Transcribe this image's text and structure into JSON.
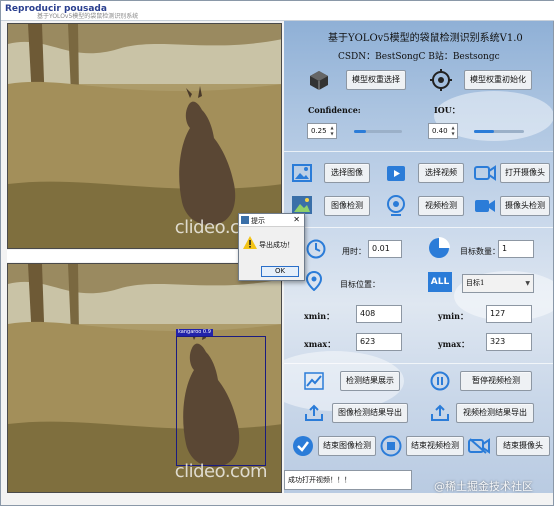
{
  "window": {
    "title": "Reproducir pousada",
    "subtitle": "基于YOLOv5模型的袋鼠检测识别系统"
  },
  "videos": {
    "watermark": "clideo.com",
    "detection_label": "kangaroo 0.9"
  },
  "panel": {
    "heading": "基于YOLOv5模型的袋鼠检测识别系统V1.0",
    "credits": "CSDN：BestSongC   B站：Bestsongc",
    "select_model_label": "模型权重选择",
    "init_model_label": "模型权重初始化",
    "confidence_label": "Confidence:",
    "confidence_value": "0.25",
    "confidence_level": 0.25,
    "iou_label": "IOU：",
    "iou_value": "0.40",
    "iou_level": 0.4,
    "select_image_label": "选择图像",
    "select_video_label": "选择视频",
    "open_camera_label": "打开摄像头",
    "image_detect_label": "图像检测",
    "video_detect_label": "视频检测",
    "camera_detect_label": "摄像头检测",
    "time_label": "用时：",
    "time_value": "0.01",
    "target_count_label": "目标数量：",
    "target_count_value": "1",
    "target_position_label": "目标位置：",
    "target_select_value": "目标1",
    "xmin_label": "xmin：",
    "xmin_value": "408",
    "ymin_label": "ymin：",
    "ymin_value": "127",
    "xmax_label": "xmax：",
    "xmax_value": "623",
    "ymax_label": "ymax：",
    "ymax_value": "323",
    "show_results_label": "检测结果展示",
    "pause_video_label": "暂停视频检测",
    "export_image_label": "图像检测结果导出",
    "export_video_label": "视频检测结果导出",
    "end_image_label": "结束图像检测",
    "end_video_label": "结束视频检测",
    "end_camera_label": "结束摄像头",
    "status_text": "成功打开视频！！！"
  },
  "dialog": {
    "title": "提示",
    "message": "导出成功！",
    "ok_label": "OK"
  },
  "watermark_footer": "@稀土掘金技术社区",
  "icons": {
    "cube": "cube-icon",
    "target": "target-icon",
    "image": "image-icon",
    "video": "video-icon",
    "camera": "camera-icon",
    "clock": "clock-icon",
    "pie": "pie-chart-icon",
    "location": "location-icon",
    "all": "all-icon",
    "chart": "line-chart-icon",
    "pause": "pause-icon",
    "upload": "upload-icon",
    "check": "check-icon",
    "stop": "stop-icon",
    "camera_off": "camera-off-icon",
    "warning": "warning-icon"
  },
  "colors": {
    "accent": "#2b7cd8",
    "title_blue": "#2a3f8f"
  }
}
